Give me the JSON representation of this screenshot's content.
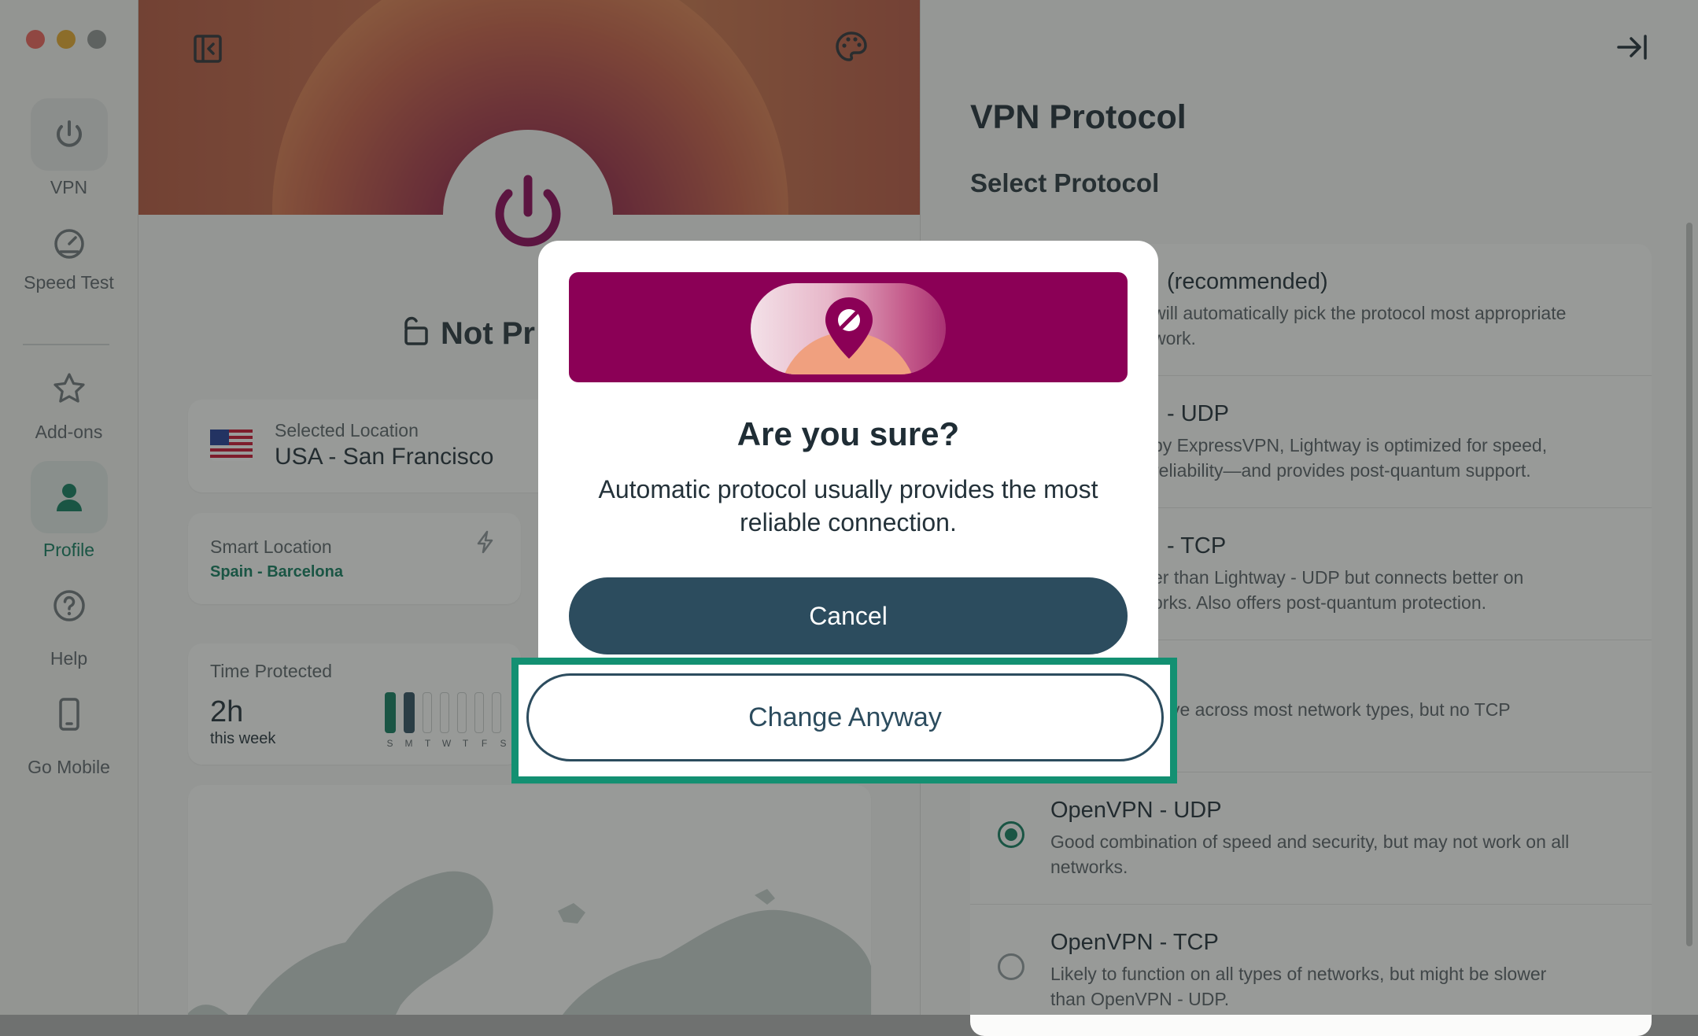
{
  "window": {
    "traffic_lights": {
      "close": "#ec5f57",
      "minimize": "#e4a62b",
      "zoom": "#8f9190"
    }
  },
  "sidebar": {
    "items": [
      {
        "label": "VPN",
        "icon": "power-icon"
      },
      {
        "label": "Speed Test",
        "icon": "speedometer-icon"
      },
      {
        "label": "Add-ons",
        "icon": "star-icon"
      },
      {
        "label": "Profile",
        "icon": "user-icon",
        "active": true
      },
      {
        "label": "Help",
        "icon": "help-circle-icon"
      },
      {
        "label": "Go Mobile",
        "icon": "phone-icon"
      }
    ]
  },
  "main": {
    "status_text": "Not Pr",
    "selected_location": {
      "label": "Selected Location",
      "value": "USA - San Francisco"
    },
    "smart_location": {
      "label": "Smart Location",
      "value": "Spain - Barcelona"
    },
    "time_protected": {
      "label": "Time Protected",
      "value": "2h",
      "period": "this week",
      "days": [
        "S",
        "M",
        "T",
        "W",
        "T",
        "F",
        "S"
      ]
    }
  },
  "protocol_panel": {
    "title": "VPN Protocol",
    "subtitle": "Select Protocol",
    "protocols": [
      {
        "name": "(recommended)",
        "desc": "will automatically pick the protocol most appropriate\nwork.",
        "selected": false
      },
      {
        "name": "- UDP",
        "desc": "by ExpressVPN, Lightway is optimized for speed,\nreliability—and provides post-quantum support.",
        "selected": false
      },
      {
        "name": "- TCP",
        "desc": "er than Lightway - UDP but connects better on\norks. Also offers post-quantum protection.",
        "selected": false
      },
      {
        "name": "",
        "desc": "ctive across most network types, but no TCP",
        "selected": false
      },
      {
        "name": "OpenVPN - UDP",
        "desc": "Good combination of speed and security, but may not work on all\nnetworks.",
        "selected": true
      },
      {
        "name": "OpenVPN - TCP",
        "desc": "Likely to function on all types of networks, but might be slower\nthan OpenVPN - UDP.",
        "selected": false
      }
    ]
  },
  "dialog": {
    "title": "Are you sure?",
    "body": "Automatic protocol usually provides the most reliable connection.",
    "cancel_label": "Cancel",
    "change_label": "Change Anyway",
    "highlight_color": "#139072"
  }
}
